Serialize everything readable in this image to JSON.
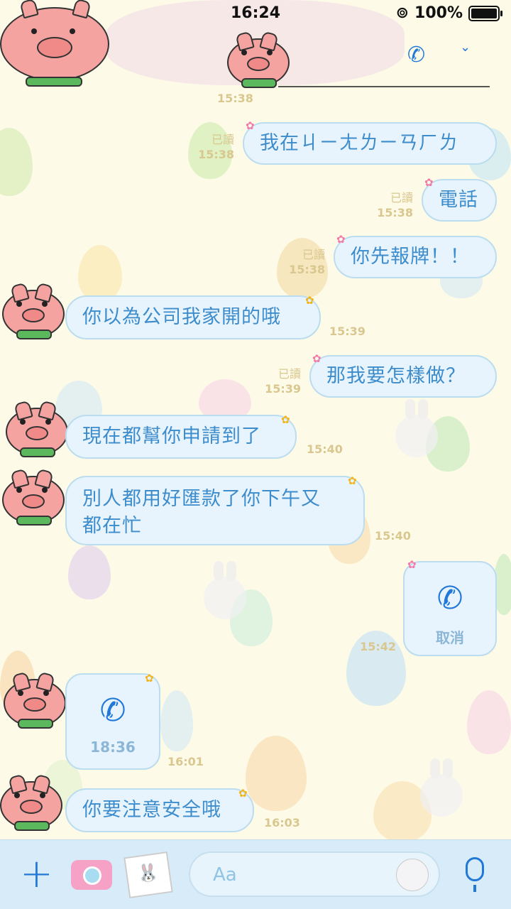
{
  "status": {
    "time": "16:24",
    "battery": "100%"
  },
  "header": {
    "call_icon": "phone-icon",
    "chevron_icon": "chevron-down-icon"
  },
  "messages": [
    {
      "time": "15:38"
    },
    {
      "side": "me",
      "text": "我在ㄐㄧㄤㄌㄧㄢㄏㄌ",
      "read": "已讀",
      "time": "15:38"
    },
    {
      "side": "me",
      "text": "電話",
      "read": "已讀",
      "time": "15:38"
    },
    {
      "side": "me",
      "text": "你先報牌！！",
      "read": "已讀",
      "time": "15:38"
    },
    {
      "side": "them",
      "text": "你以為公司我家開的哦",
      "time": "15:39"
    },
    {
      "side": "me",
      "text": "那我要怎樣做？",
      "read": "已讀",
      "time": "15:39"
    },
    {
      "side": "them",
      "text": "現在都幫你申請到了",
      "time": "15:40"
    },
    {
      "side": "them",
      "text": "別人都用好匯款了你下午又都在忙",
      "line1": "別人都用好匯款了你下午又",
      "line2": "都在忙",
      "time": "15:40"
    },
    {
      "side": "me",
      "type": "call",
      "call_label": "取消",
      "time": "15:42"
    },
    {
      "side": "them",
      "type": "call",
      "call_label": "18:36",
      "time": "16:01"
    },
    {
      "side": "them",
      "text": "你要注意安全哦",
      "time": "16:03"
    }
  ],
  "input": {
    "placeholder": "Aa"
  },
  "colors": {
    "bubble": "#e7f4fd",
    "text": "#3d8ccc",
    "accent": "#2178d8",
    "meta": "#d9c78f"
  }
}
